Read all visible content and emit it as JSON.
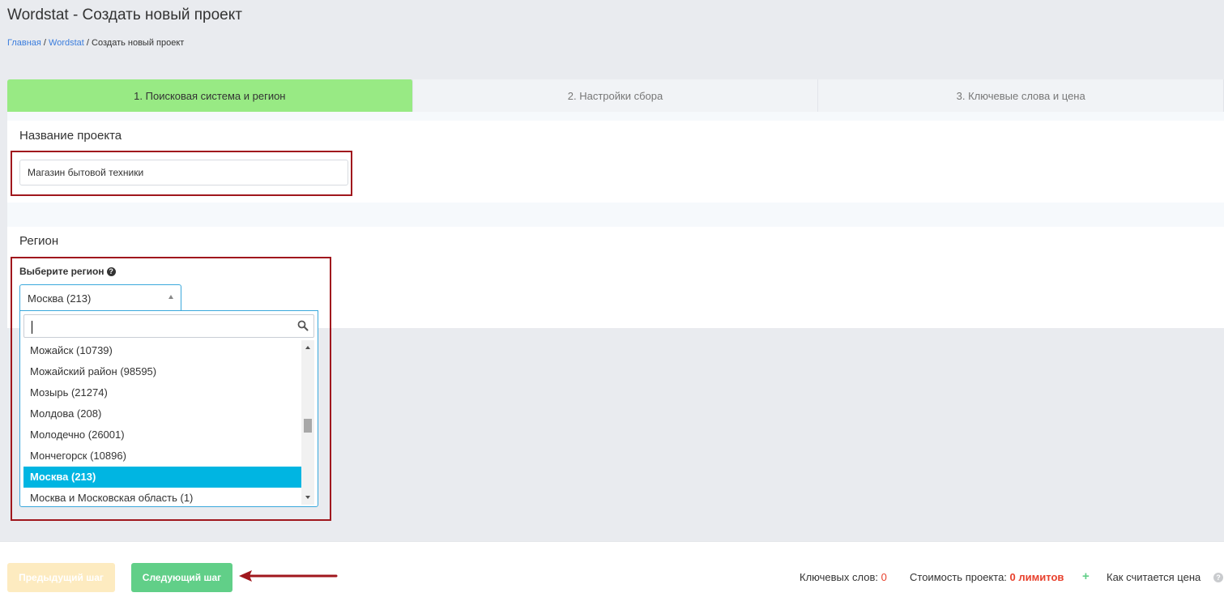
{
  "page": {
    "title": "Wordstat - Создать новый проект",
    "breadcrumb": {
      "home": "Главная",
      "separator1": " / ",
      "section": "Wordstat",
      "separator2": " / ",
      "current": "Создать новый проект"
    }
  },
  "tabs": [
    {
      "label": "1. Поисковая система и регион",
      "active": true
    },
    {
      "label": "2. Настройки сбора",
      "active": false
    },
    {
      "label": "3. Ключевые слова и цена",
      "active": false
    }
  ],
  "project_name": {
    "title": "Название проекта",
    "value": "Магазин бытовой техники"
  },
  "region": {
    "title": "Регион",
    "label": "Выберите регион",
    "help_icon": "question-circle-icon",
    "selected": "Москва (213)",
    "search_value": "",
    "options": [
      {
        "label": "Можайск (10739)",
        "selected": false
      },
      {
        "label": "Можайский район (98595)",
        "selected": false
      },
      {
        "label": "Мозырь (21274)",
        "selected": false
      },
      {
        "label": "Молдова (208)",
        "selected": false
      },
      {
        "label": "Молодечно (26001)",
        "selected": false
      },
      {
        "label": "Мончегорск (10896)",
        "selected": false
      },
      {
        "label": "Москва (213)",
        "selected": true
      },
      {
        "label": "Москва и Московская область (1)",
        "selected": false
      }
    ]
  },
  "footer": {
    "prev_button": "Предыдущий шаг",
    "next_button": "Следующий шаг",
    "keywords_label": "Ключевых слов:",
    "keywords_value": "0",
    "cost_label": "Стоимость проекта:",
    "cost_value": "0 лимитов",
    "plus": "+",
    "how_price_label": "Как считается цена",
    "help_icon": "?"
  },
  "colors": {
    "active_tab": "#98ea84",
    "highlight_border": "#a0171d",
    "selected_option": "#00b5e2",
    "next_button": "#61cf88",
    "prev_button": "#fdebc0",
    "accent_red": "#e8412d"
  }
}
